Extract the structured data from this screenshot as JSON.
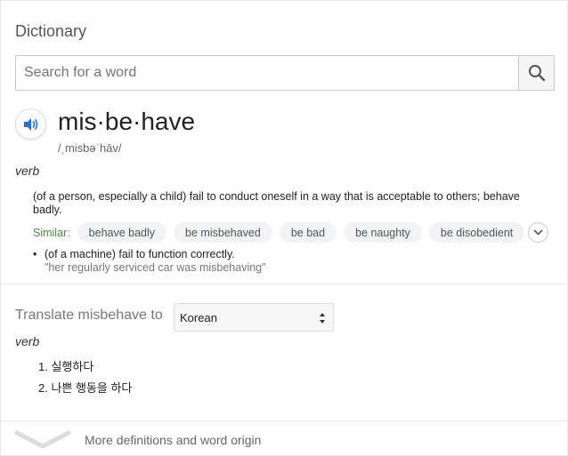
{
  "header": {
    "title": "Dictionary"
  },
  "search": {
    "placeholder": "Search for a word"
  },
  "entry": {
    "word": "mis·be·have",
    "phonetic": "/ˌmisbəˈhāv/",
    "part_of_speech": "verb",
    "definitions": [
      {
        "text": "(of a person, especially a child) fail to conduct oneself in a way that is acceptable to others; behave badly."
      },
      {
        "bullet": "•",
        "text": "(of a machine) fail to function correctly.",
        "example": "\"her regularly serviced car was misbehaving\""
      }
    ],
    "similar": {
      "label": "Similar:",
      "words": [
        "behave badly",
        "be misbehaved",
        "be bad",
        "be naughty",
        "be disobedient"
      ]
    }
  },
  "translate": {
    "label": "Translate misbehave to",
    "selected_language": "Korean",
    "part_of_speech": "verb",
    "items": [
      "1. 실행하다",
      "2. 나쁜 행동을 하다"
    ]
  },
  "footer": {
    "more_label": "More definitions and word origin"
  },
  "colors": {
    "accent": "#1a73e8",
    "similar_label": "#4c8a3e",
    "chip_bg": "#f1f3f4"
  }
}
